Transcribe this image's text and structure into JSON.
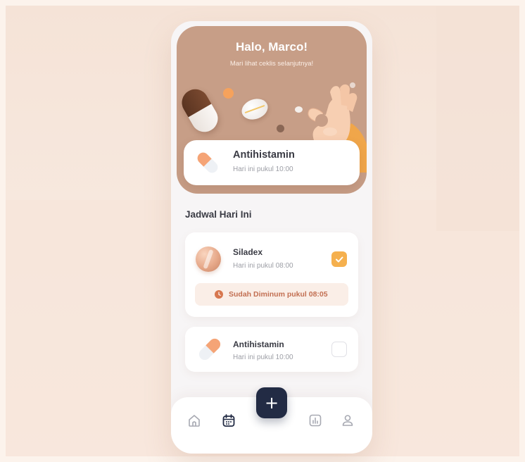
{
  "header": {
    "greeting": "Halo, Marco!",
    "subtitle": "Mari lihat ceklis selanjutnya!"
  },
  "next_reminder": {
    "medicine": "Antihistamin",
    "time": "Hari ini pukul 10:00"
  },
  "schedule": {
    "title": "Jadwal Hari Ini",
    "items": [
      {
        "medicine": "Siladex",
        "time": "Hari ini pukul 08:00",
        "checked": true,
        "status": "Sudah Diminum pukul 08:05"
      },
      {
        "medicine": "Antihistamin",
        "time": "Hari ini pukul 10:00",
        "checked": false
      }
    ]
  },
  "nav": {
    "add_label": "+",
    "items": [
      {
        "icon": "home-icon",
        "active": false
      },
      {
        "icon": "calendar-icon",
        "active": true
      },
      {
        "icon": "chart-icon",
        "active": false
      },
      {
        "icon": "profile-icon",
        "active": false
      }
    ]
  },
  "colors": {
    "brand": "#c79e87",
    "accent": "#f5b04e",
    "status_text": "#c26f52",
    "nav_button": "#222b44"
  }
}
